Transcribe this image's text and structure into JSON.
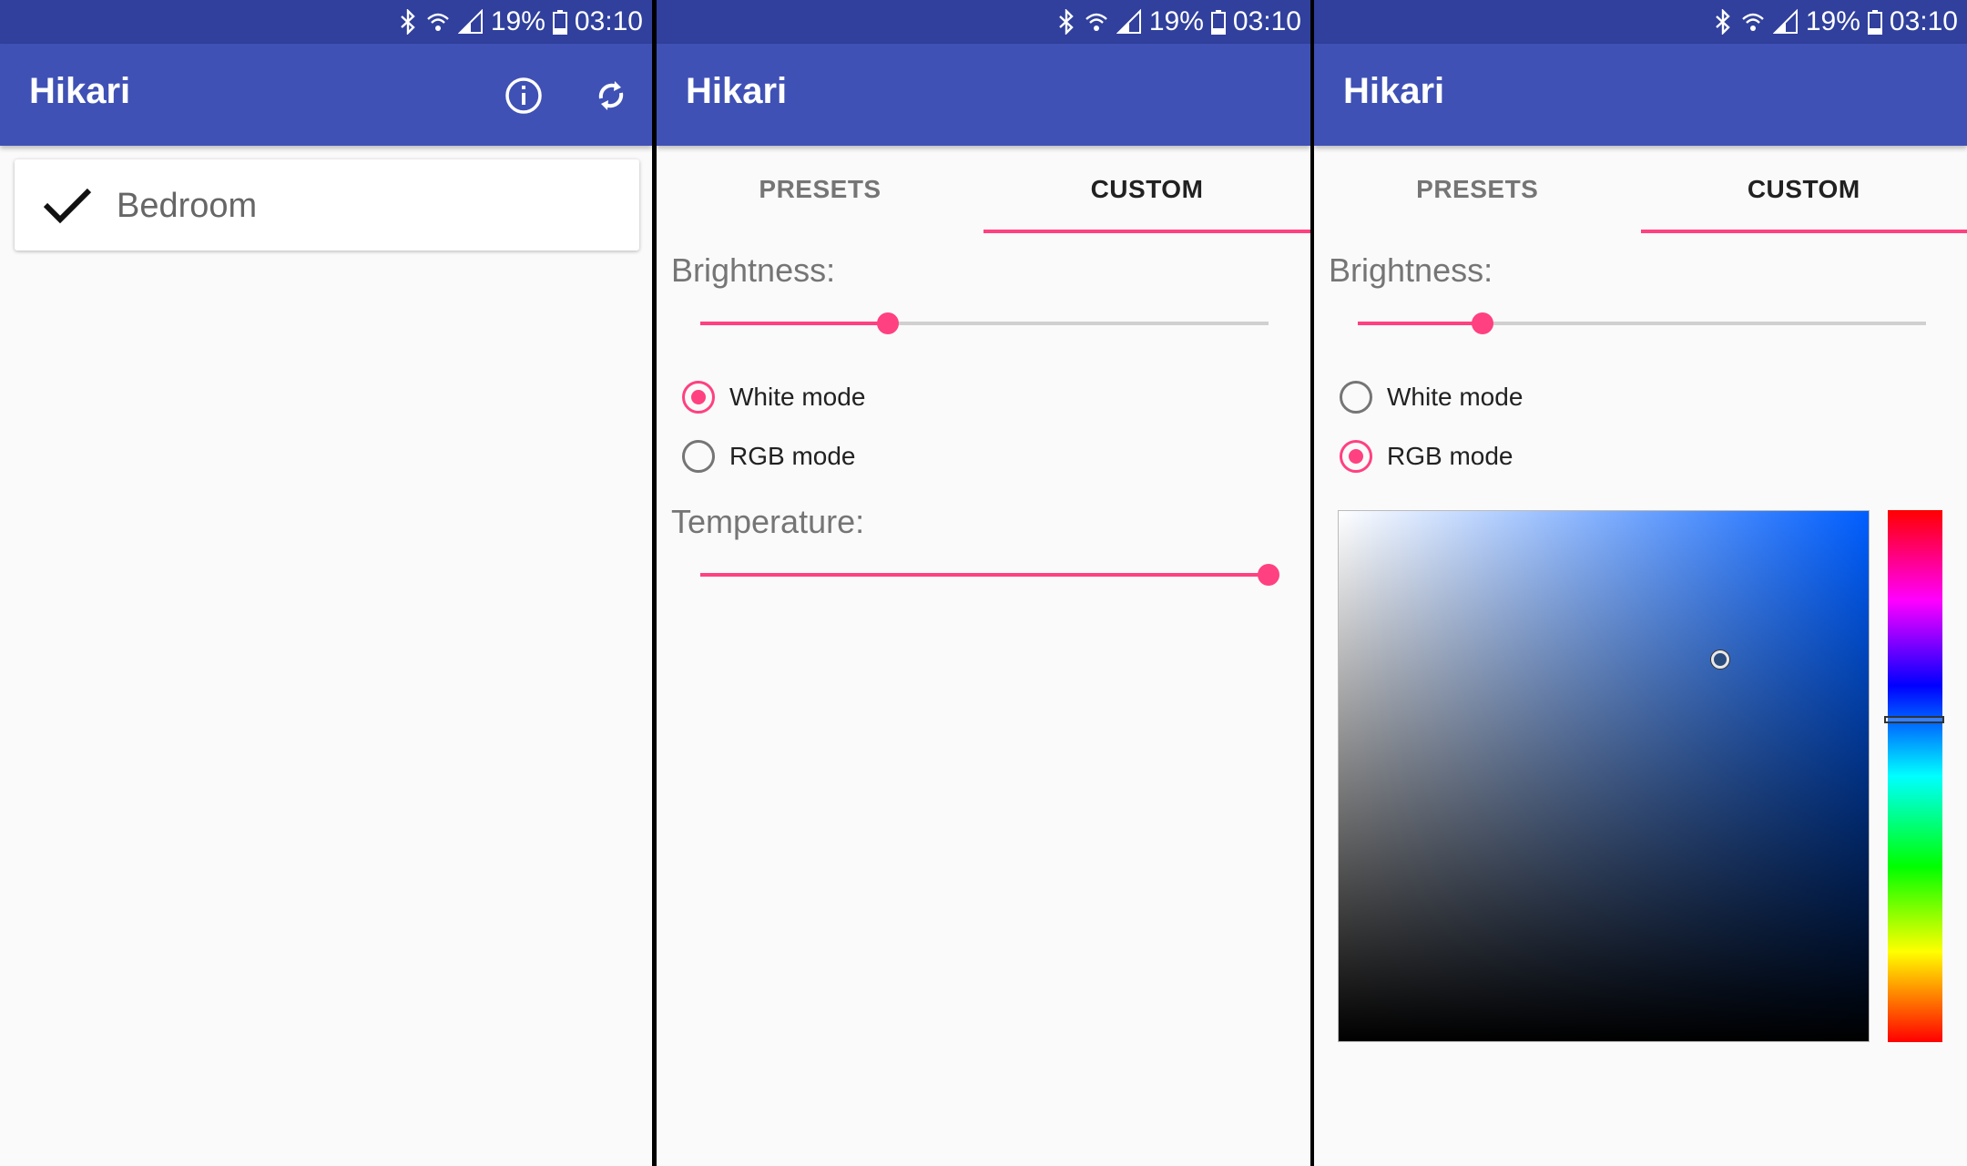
{
  "status_bar": {
    "battery": "19%",
    "time": "03:10"
  },
  "app": {
    "title": "Hikari"
  },
  "screens": {
    "rooms": {
      "rooms": [
        {
          "label": "Bedroom",
          "selected": true
        }
      ]
    },
    "custom_white": {
      "tabs": [
        {
          "label": "PRESETS",
          "active": false
        },
        {
          "label": "CUSTOM",
          "active": true
        }
      ],
      "brightness_label": "Brightness:",
      "brightness_value": 0.33,
      "modes": [
        {
          "label": "White mode",
          "checked": true
        },
        {
          "label": "RGB mode",
          "checked": false
        }
      ],
      "temperature_label": "Temperature:",
      "temperature_value": 1.0
    },
    "custom_rgb": {
      "tabs": [
        {
          "label": "PRESETS",
          "active": false
        },
        {
          "label": "CUSTOM",
          "active": true
        }
      ],
      "brightness_label": "Brightness:",
      "brightness_value": 0.22,
      "modes": [
        {
          "label": "White mode",
          "checked": false
        },
        {
          "label": "RGB mode",
          "checked": true
        }
      ],
      "color_picker": {
        "hue_deg": 218,
        "saturation": 0.72,
        "value": 0.72
      }
    }
  },
  "colors": {
    "primary": "#3f51b5",
    "primary_dark": "#30409c",
    "accent": "#ff4081"
  },
  "icons": {
    "info": "info-icon",
    "refresh": "refresh-icon",
    "check": "check-icon"
  }
}
